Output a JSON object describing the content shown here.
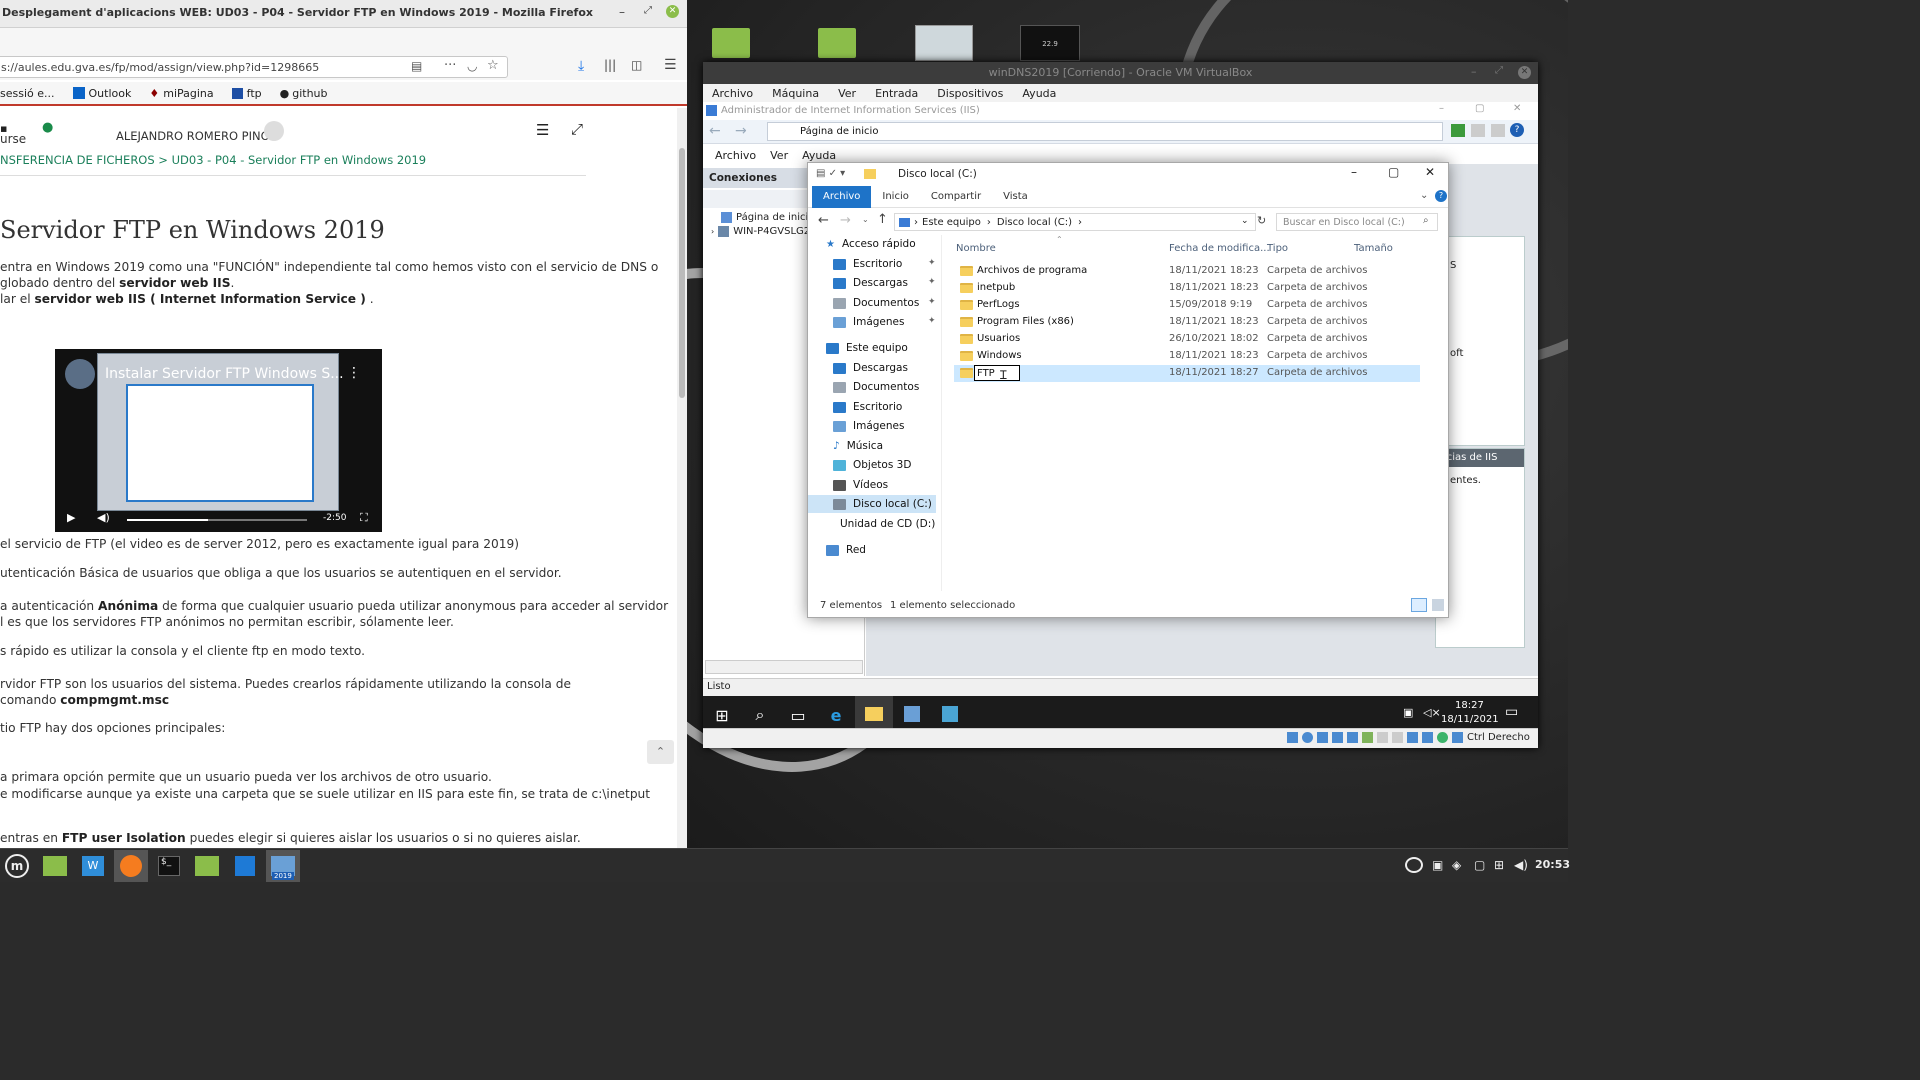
{
  "firefox": {
    "title": "Desplegament d'aplicacions WEB: UD03 - P04 - Servidor FTP en Windows 2019 - Mozilla Firefox",
    "url": "s://aules.edu.gva.es/fp/mod/assign/view.php?id=1298665",
    "bookmarks": [
      "sessió e...",
      "Outlook",
      "miPagina",
      "ftp",
      "github"
    ],
    "user_name": "ALEJANDRO ROMERO PINO",
    "left_nav_label": "urse",
    "breadcrumb": "NSFERENCIA DE FICHEROS  >  UD03 - P04 - Servidor FTP en Windows 2019",
    "heading": "Servidor FTP en Windows 2019",
    "video_title": "Instalar Servidor FTP Windows S...",
    "video_time": "-2:50",
    "paragraphs": {
      "p1a": "entra en Windows 2019 como una \"FUNCIÓN\" independiente tal como hemos visto con el servicio de DNS o",
      "p1b_pre": "globado dentro del ",
      "p1b_bold": "servidor web IIS",
      "p1b_post": ".",
      "p1c_pre": "lar el ",
      "p1c_bold": "servidor web IIS ( Internet Information Service )",
      "p1c_post": " .",
      "p2": " el servicio de FTP (el video es de server 2012, pero es exactamente igual para 2019)",
      "p3": "utenticación Básica de usuarios que obliga a que los usuarios se autentiquen en el servidor.",
      "p4a_pre": "a autenticación ",
      "p4a_bold": "Anónima",
      "p4a_post": " de forma que cualquier usuario pueda utilizar anonymous para acceder al servidor",
      "p4b": "l es que los servidores FTP anónimos no permitan escribir, sólamente leer.",
      "p5": "s rápido es utilizar la consola y el cliente ftp en modo texto.",
      "p6a": "rvidor FTP son los usuarios del sistema. Puedes crearlos rápidamente utilizando la consola de",
      "p6b_pre": "comando ",
      "p6b_bold": "compmgmt.msc",
      "p7": "tio FTP hay dos opciones principales:",
      "p8a": "a primara opción permite que un usuario pueda ver los archivos de otro usuario.",
      "p8b": "e modificarse aunque ya existe una carpeta que se suele utilizar en IIS para este fin, se trata de c:\\inetput",
      "p9_pre": "entras en ",
      "p9_bold": "FTP user Isolation",
      "p9_post": " puedes elegir si quieres aislar los usuarios o si no quieres aislar."
    }
  },
  "desktop_thumb_value": "22.9",
  "vbox": {
    "title": "winDNS2019 [Corriendo] - Oracle VM VirtualBox",
    "menu": [
      "Archivo",
      "Máquina",
      "Ver",
      "Entrada",
      "Dispositivos",
      "Ayuda"
    ],
    "status_text": "Ctrl Derecho"
  },
  "iis": {
    "title": "Administrador de Internet Information Services (IIS)",
    "nav_path": "Página de inicio",
    "menu": [
      "Archivo",
      "Ver",
      "Ayuda"
    ],
    "connections_title": "Conexiones",
    "tree": [
      "Página de inicio",
      "WIN-P4GVSLG2I"
    ],
    "status": "Listo",
    "right_text_1": "S",
    "right_text_2": "oft",
    "right_panel_title": "ticias de IIS",
    "right_text_3": "entes."
  },
  "explorer": {
    "title": "Disco local (C:)",
    "ribbon_tabs": [
      "Archivo",
      "Inicio",
      "Compartir",
      "Vista"
    ],
    "address": [
      "Este equipo",
      "Disco local (C:)"
    ],
    "search_placeholder": "Buscar en Disco local (C:)",
    "nav": {
      "quick": "Acceso rápido",
      "quick_items": [
        "Escritorio",
        "Descargas",
        "Documentos",
        "Imágenes"
      ],
      "pc": "Este equipo",
      "pc_items": [
        "Descargas",
        "Documentos",
        "Escritorio",
        "Imágenes",
        "Música",
        "Objetos 3D",
        "Vídeos",
        "Disco local (C:)",
        "Unidad de CD (D:) S"
      ],
      "network": "Red"
    },
    "columns": [
      "Nombre",
      "Fecha de modifica...",
      "Tipo",
      "Tamaño"
    ],
    "rows": [
      {
        "name": "Archivos de programa",
        "date": "18/11/2021 18:23",
        "type": "Carpeta de archivos"
      },
      {
        "name": "inetpub",
        "date": "18/11/2021 18:23",
        "type": "Carpeta de archivos"
      },
      {
        "name": "PerfLogs",
        "date": "15/09/2018 9:19",
        "type": "Carpeta de archivos"
      },
      {
        "name": "Program Files (x86)",
        "date": "18/11/2021 18:23",
        "type": "Carpeta de archivos"
      },
      {
        "name": "Usuarios",
        "date": "26/10/2021 18:02",
        "type": "Carpeta de archivos"
      },
      {
        "name": "Windows",
        "date": "18/11/2021 18:23",
        "type": "Carpeta de archivos"
      },
      {
        "name": "FTP",
        "date": "18/11/2021 18:27",
        "type": "Carpeta de archivos"
      }
    ],
    "status_count": "7 elementos",
    "status_selected": "1 elemento seleccionado"
  },
  "guest_taskbar": {
    "time": "18:27",
    "date": "18/11/2021"
  },
  "host_taskbar": {
    "time": "20:53",
    "vbox_badge": "2019"
  }
}
